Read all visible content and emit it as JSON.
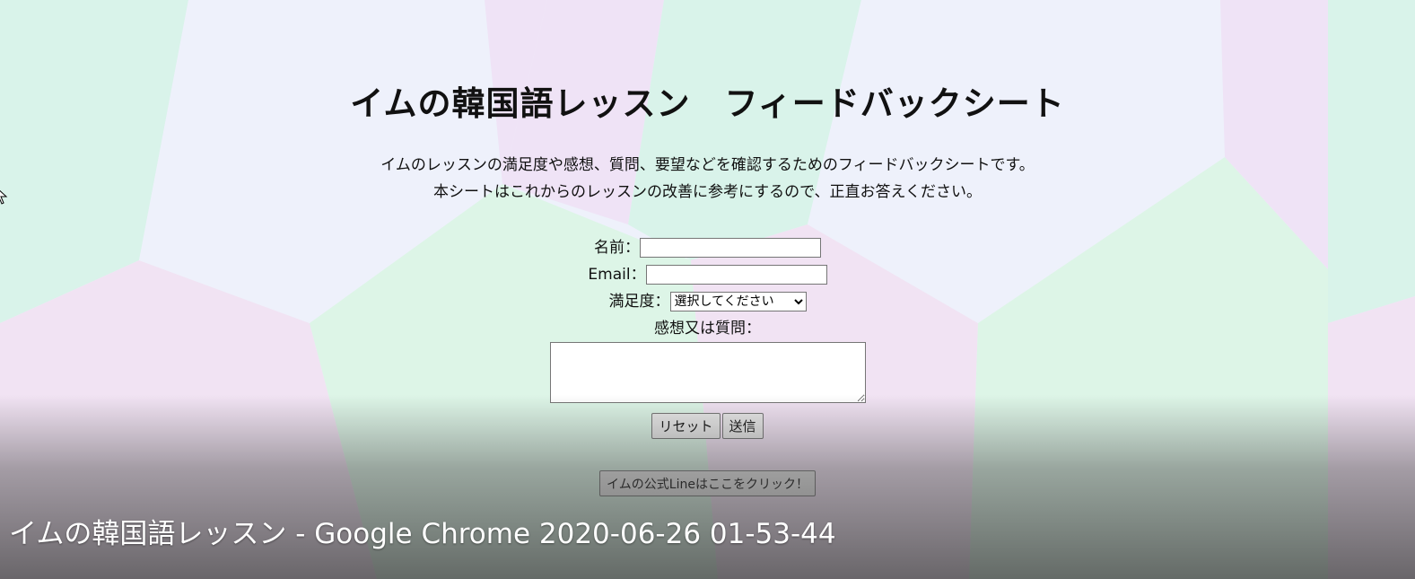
{
  "page": {
    "title": "イムの韓国語レッスン　フィードバックシート",
    "description_line1": "イムのレッスンの満足度や感想、質問、要望などを確認するためのフィードバックシートです。",
    "description_line2": "本シートはこれからのレッスンの改善に参考にするので、正直お答えください。"
  },
  "form": {
    "name_label": "名前：",
    "name_value": "",
    "email_label": "Email：",
    "email_value": "",
    "satisfaction_label": "満足度：",
    "satisfaction_selected": "選択してください",
    "comment_label": "感想又は質問：",
    "comment_value": "",
    "reset_label": "リセット",
    "submit_label": "送信"
  },
  "line_button_label": "イムの公式Lineはここをクリック！",
  "video_caption": "イムの韓国語レッスン - Google Chrome 2020-06-26 01-53-44",
  "colors": {
    "mint": "#d9f3ea",
    "lavender": "#eef1fb",
    "pink": "#f1e3f3",
    "green": "#ddf5e7",
    "button_bg": "#e9e9e9"
  },
  "icons": {
    "cursor": "mouse-pointer-icon",
    "select_arrow": "chevron-down-icon"
  }
}
